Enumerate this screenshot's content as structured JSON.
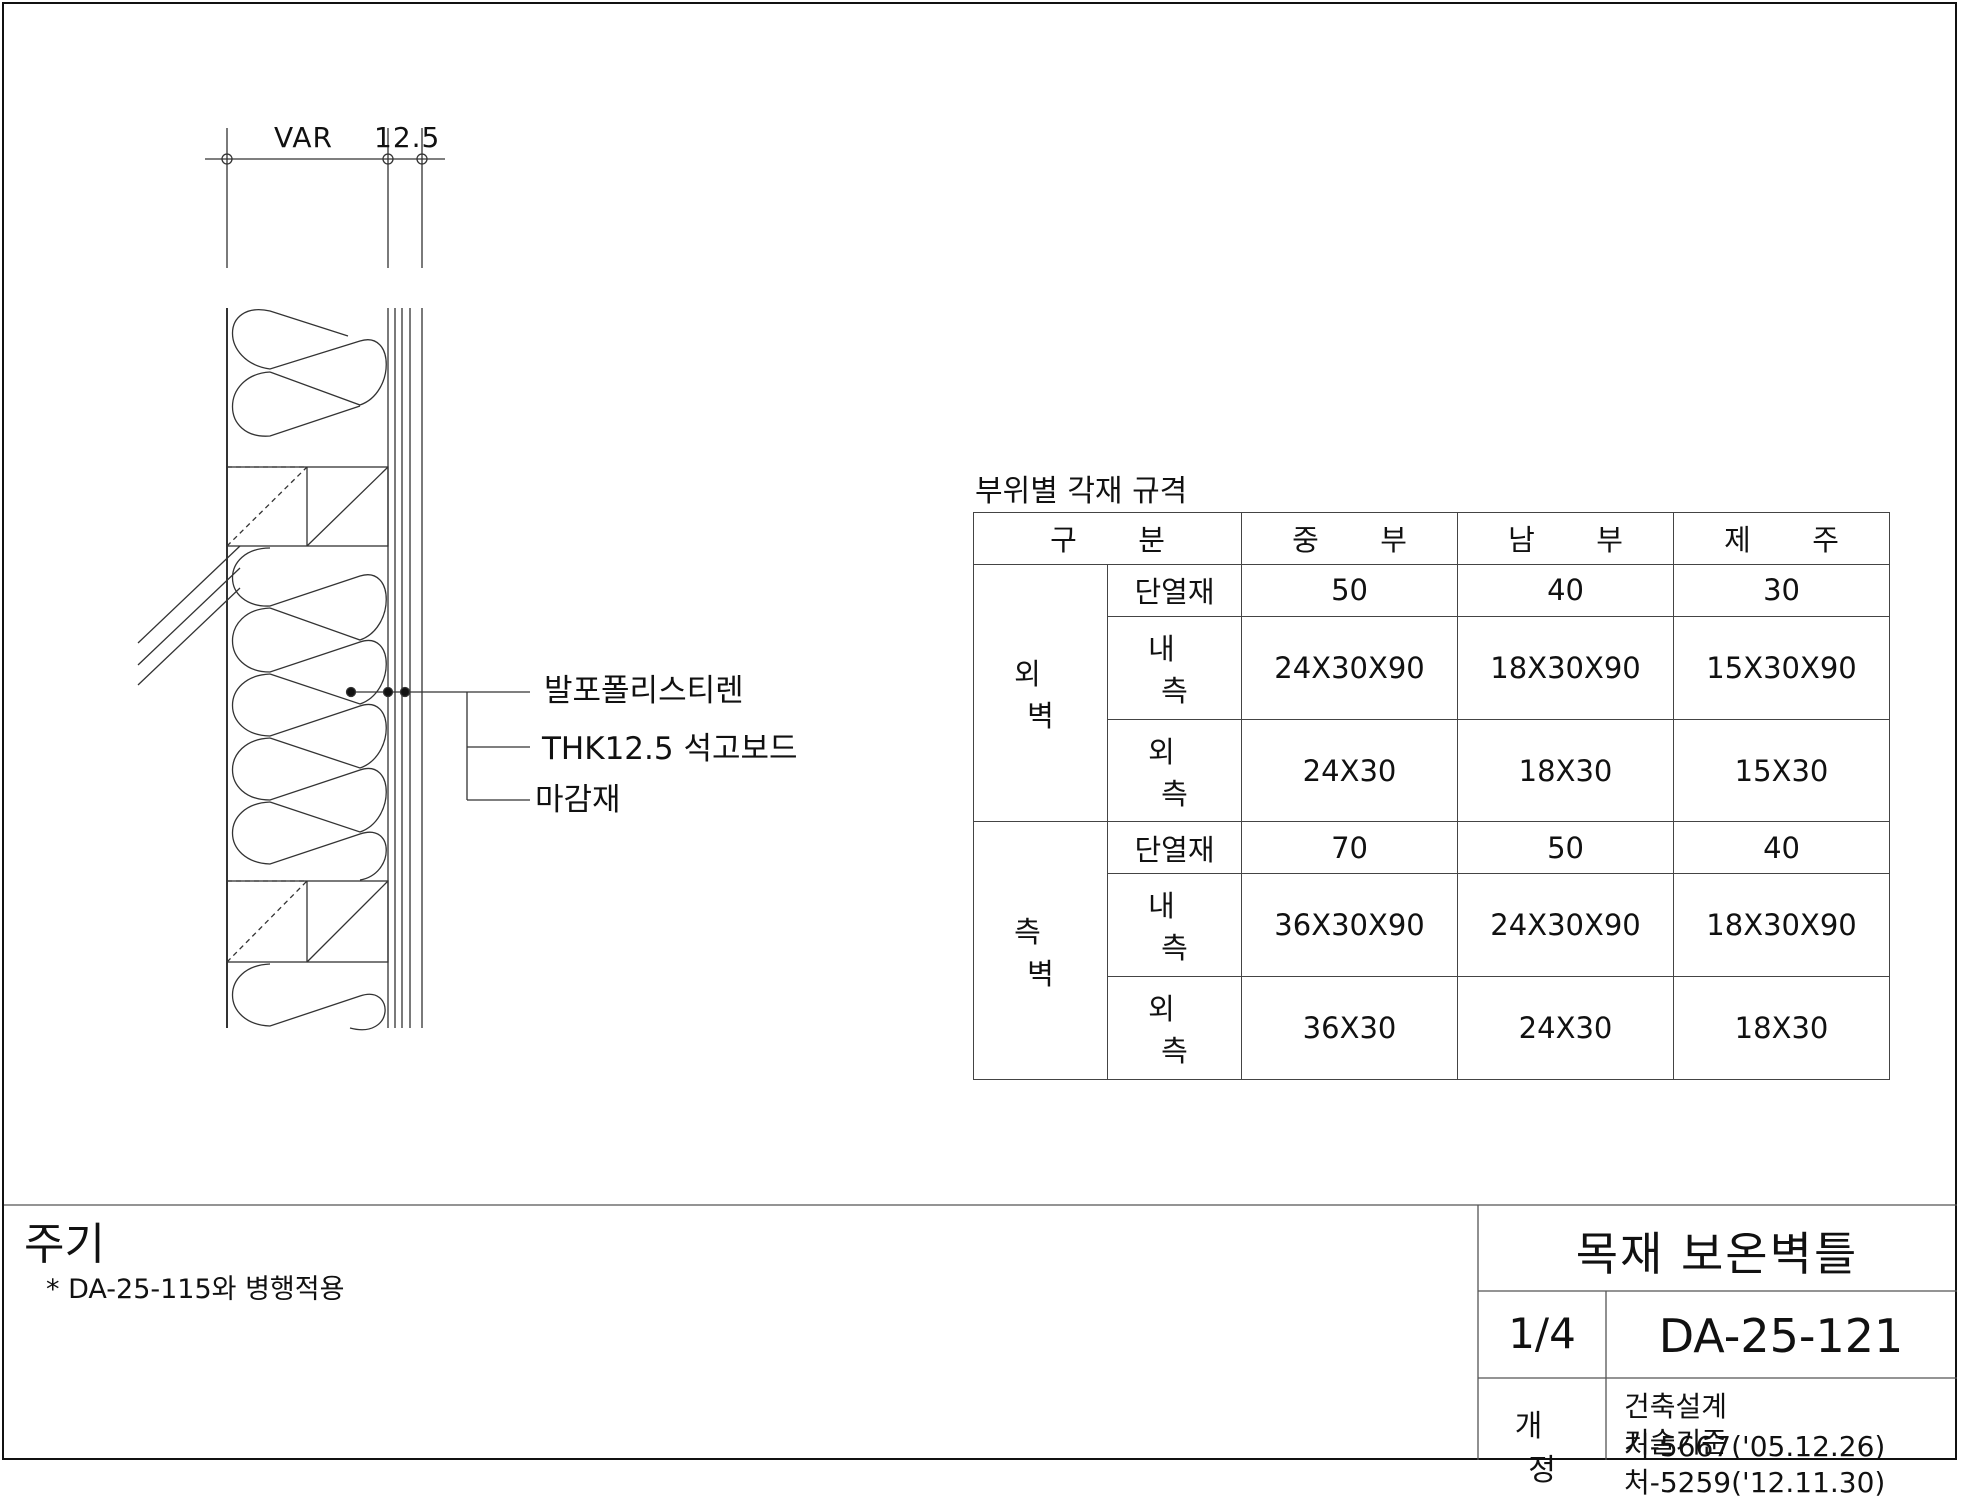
{
  "dimensions": {
    "var_label": "VAR",
    "board_thk": "12.5"
  },
  "callouts": [
    {
      "label": "발포폴리스티렌"
    },
    {
      "label": "THK12.5 석고보드"
    },
    {
      "label": "마감재"
    }
  ],
  "spec_table": {
    "title": "부위별 각재 규격",
    "header": {
      "category": "구 분",
      "regions": [
        "중 부",
        "남 부",
        "제 주"
      ]
    },
    "groups": [
      {
        "name": "외 벽",
        "rows": [
          {
            "item": "단열재",
            "values": [
              "50",
              "40",
              "30"
            ]
          },
          {
            "item": "내 측",
            "values": [
              "24X30X90",
              "18X30X90",
              "15X30X90"
            ]
          },
          {
            "item": "외 측",
            "values": [
              "24X30",
              "18X30",
              "15X30"
            ]
          }
        ]
      },
      {
        "name": "측 벽",
        "rows": [
          {
            "item": "단열재",
            "values": [
              "70",
              "50",
              "40"
            ]
          },
          {
            "item": "내 측",
            "values": [
              "36X30X90",
              "24X30X90",
              "18X30X90"
            ]
          },
          {
            "item": "외 측",
            "values": [
              "36X30",
              "24X30",
              "18X30"
            ]
          }
        ]
      }
    ]
  },
  "notes": {
    "title": "주기",
    "items": [
      "* DA-25-115와 병행적용"
    ]
  },
  "title_block": {
    "drawing_title": "목재 보온벽틀",
    "sheet": "1/4",
    "drawing_no": "DA-25-121",
    "revision_label": "개 정",
    "revisions": [
      "건축설계처-5667('05.12.26)",
      "기술기준처-5259('12.11.30)"
    ]
  }
}
